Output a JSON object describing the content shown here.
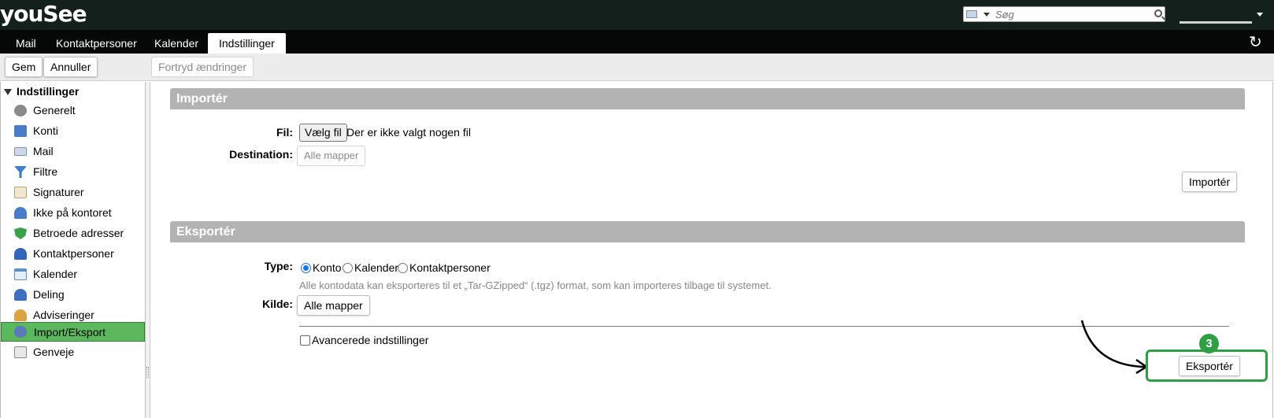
{
  "app": {
    "logo": "youSee"
  },
  "search": {
    "placeholder": "Søg"
  },
  "tabs": [
    {
      "label": "Mail"
    },
    {
      "label": "Kontaktpersoner"
    },
    {
      "label": "Kalender"
    },
    {
      "label": "Indstillinger",
      "active": true
    }
  ],
  "toolbar": {
    "save_label": "Gem",
    "cancel_label": "Annuller",
    "undo_label": "Fortryd ændringer"
  },
  "sidebar": {
    "title": "Indstillinger",
    "items": [
      {
        "label": "Generelt",
        "icon": "gear-icon",
        "color": "#8a8a8a"
      },
      {
        "label": "Konti",
        "icon": "account-icon",
        "color": "#4a7cc7"
      },
      {
        "label": "Mail",
        "icon": "envelope-icon",
        "color": "#9fb3d6"
      },
      {
        "label": "Filtre",
        "icon": "filter-icon",
        "color": "#3c7fd0"
      },
      {
        "label": "Signaturer",
        "icon": "signature-icon",
        "color": "#c9b27a"
      },
      {
        "label": "Ikke på kontoret",
        "icon": "out-of-office-icon",
        "color": "#4a7cc7"
      },
      {
        "label": "Betroede adresser",
        "icon": "shield-icon",
        "color": "#3aa14b"
      },
      {
        "label": "Kontaktpersoner",
        "icon": "person-icon",
        "color": "#3366bb"
      },
      {
        "label": "Kalender",
        "icon": "calendar-icon",
        "color": "#5b8fd6"
      },
      {
        "label": "Deling",
        "icon": "sharing-icon",
        "color": "#3d6fc2"
      },
      {
        "label": "Adviseringer",
        "icon": "bell-icon",
        "color": "#d9a441"
      },
      {
        "label": "Import/Eksport",
        "icon": "import-export-icon",
        "color": "#5a79b8",
        "active": true
      },
      {
        "label": "Genveje",
        "icon": "keyboard-icon",
        "color": "#9a9a9a"
      }
    ]
  },
  "import": {
    "title": "Importér",
    "file_label": "Fil:",
    "choose_file_label": "Vælg fil",
    "no_file_text": "Der er ikke valgt nogen fil",
    "destination_label": "Destination:",
    "destination_value": "Alle mapper",
    "import_button": "Importér"
  },
  "export": {
    "title": "Eksportér",
    "type_label": "Type:",
    "type_options": [
      {
        "label": "Konto",
        "selected": true
      },
      {
        "label": "Kalender",
        "selected": false
      },
      {
        "label": "Kontaktpersoner",
        "selected": false
      }
    ],
    "hint": "Alle kontodata kan eksporteres til et „Tar-GZipped“ (.tgz) format, som kan importeres tilbage til systemet.",
    "source_label": "Kilde:",
    "source_value": "Alle mapper",
    "advanced_label": "Avancerede indstillinger",
    "export_button": "Eksportér"
  },
  "annotation": {
    "step": "3",
    "color": "#2ea043"
  }
}
